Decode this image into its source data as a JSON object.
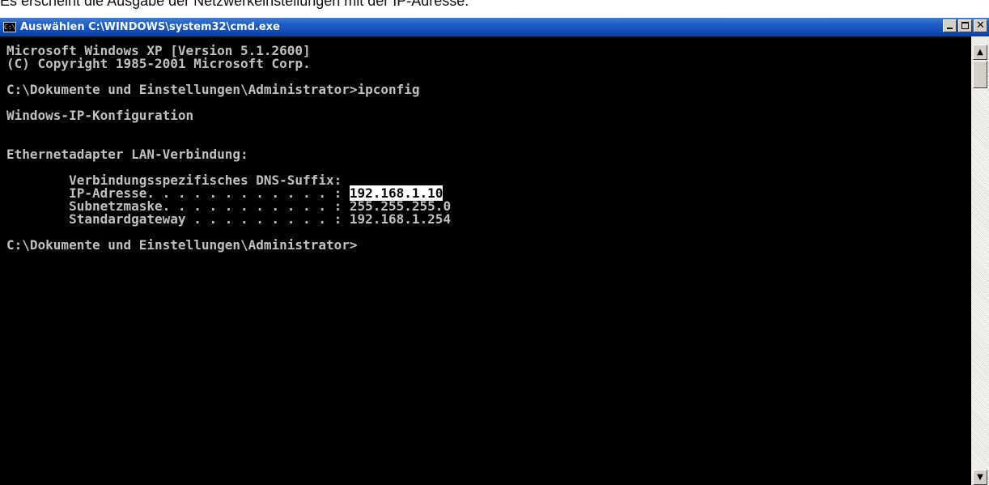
{
  "caption": "Es erscheint die Ausgabe der Netzwerkeinstellungen mit der IP-Adresse.",
  "window": {
    "title": "Auswählen C:\\WINDOWS\\system32\\cmd.exe",
    "icon_label": "C:\\",
    "controls": {
      "minimize": "_",
      "maximize": "□",
      "close": "✕"
    }
  },
  "console": {
    "line1": "Microsoft Windows XP [Version 5.1.2600]",
    "line2": "(C) Copyright 1985-2001 Microsoft Corp.",
    "line3": "C:\\Dokumente und Einstellungen\\Administrator>ipconfig",
    "line4": "Windows-IP-Konfiguration",
    "line5": "Ethernetadapter LAN-Verbindung:",
    "dns_suffix": "        Verbindungsspezifisches DNS-Suffix:",
    "ip_label": "        IP-Adresse. . . . . . . . . . . . : ",
    "ip_value": "192.168.1.10",
    "subnet_label": "        Subnetzmaske. . . . . . . . . . . : ",
    "subnet_value": "255.255.255.0",
    "gateway_label": "        Standardgateway . . . . . . . . . : ",
    "gateway_value": "192.168.1.254",
    "prompt": "C:\\Dokumente und Einstellungen\\Administrator>"
  },
  "scrollbar": {
    "up_arrow": "▲",
    "down_arrow": "▼"
  },
  "colors": {
    "titlebar": "#0a3fa8",
    "console_bg": "#000000",
    "console_text": "#c0c0c0",
    "selection_bg": "#ffffff"
  }
}
